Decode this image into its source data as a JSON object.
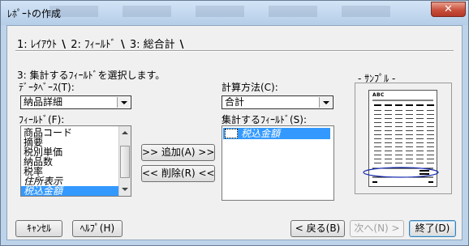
{
  "window": {
    "title": "ﾚﾎﾟｰﾄの作成",
    "close_glyph": "✕"
  },
  "tabs": [
    {
      "label": "1: ﾚｲｱｳﾄ",
      "active": false
    },
    {
      "label": "2: ﾌｨｰﾙﾄﾞ",
      "active": false
    },
    {
      "label": "3: 総合計",
      "active": true
    }
  ],
  "tab_separator": "\\",
  "instruction": "3: 集計するﾌｨｰﾙﾄﾞを選択します。",
  "database": {
    "label": "ﾃﾞｰﾀﾍﾞｰｽ(T):",
    "value": "納品詳細"
  },
  "fields": {
    "label": "ﾌｨｰﾙﾄﾞ(F):",
    "items": [
      {
        "text": "商品コード",
        "italic": false,
        "selected": false
      },
      {
        "text": "摘要",
        "italic": false,
        "selected": false
      },
      {
        "text": "税別単価",
        "italic": false,
        "selected": false
      },
      {
        "text": "納品数",
        "italic": false,
        "selected": false
      },
      {
        "text": "税率",
        "italic": false,
        "selected": false
      },
      {
        "text": "住所表示",
        "italic": true,
        "selected": false
      },
      {
        "text": "税込金額",
        "italic": true,
        "selected": true
      }
    ]
  },
  "buttons": {
    "add": ">> 追加(A) >>",
    "remove": "<< 削除(R) <<",
    "cancel": "ｷｬﾝｾﾙ",
    "help": "ﾍﾙﾌﾟ(H)",
    "back": "< 戻る(B)",
    "next": "次へ(N) >",
    "finish": "終了(D)"
  },
  "calc_method": {
    "label": "計算方法(C):",
    "value": "合計"
  },
  "summary_fields": {
    "label": "集計するﾌｨｰﾙﾄﾞ(S):",
    "items": [
      {
        "text": "税込金額",
        "italic": true,
        "selected": true
      }
    ]
  },
  "sample": {
    "label": "- ｻﾝﾌﾟﾙ -",
    "header_text": "ABC"
  },
  "colors": {
    "selection": "#3399ff",
    "title_bar": "#bcd3ea",
    "close_button": "#c9503c",
    "highlight_oval": "#1a2fb0"
  }
}
